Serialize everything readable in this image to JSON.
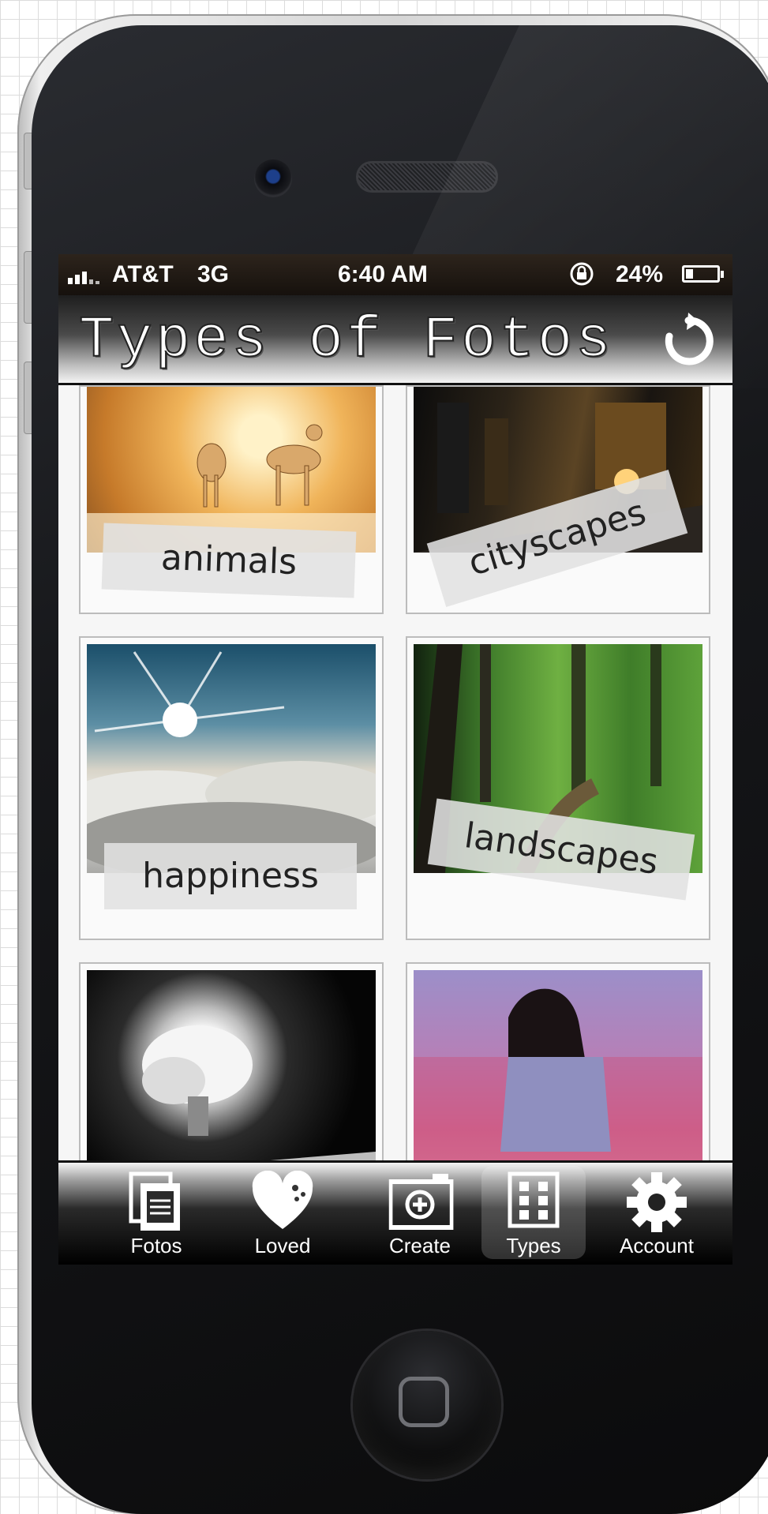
{
  "status_bar": {
    "carrier": "AT&T",
    "network": "3G",
    "time": "6:40 AM",
    "battery": "24%"
  },
  "nav": {
    "title": "Types of Fotos"
  },
  "categories": [
    {
      "label": "animals"
    },
    {
      "label": "cityscapes"
    },
    {
      "label": "happiness"
    },
    {
      "label": "landscapes"
    }
  ],
  "tabs": [
    {
      "label": "Fotos",
      "icon": "photos-icon"
    },
    {
      "label": "Loved",
      "icon": "heart-icon"
    },
    {
      "label": "Create",
      "icon": "camera-add-icon"
    },
    {
      "label": "Types",
      "icon": "grid-icon",
      "active": true
    },
    {
      "label": "Account",
      "icon": "gear-icon"
    }
  ]
}
